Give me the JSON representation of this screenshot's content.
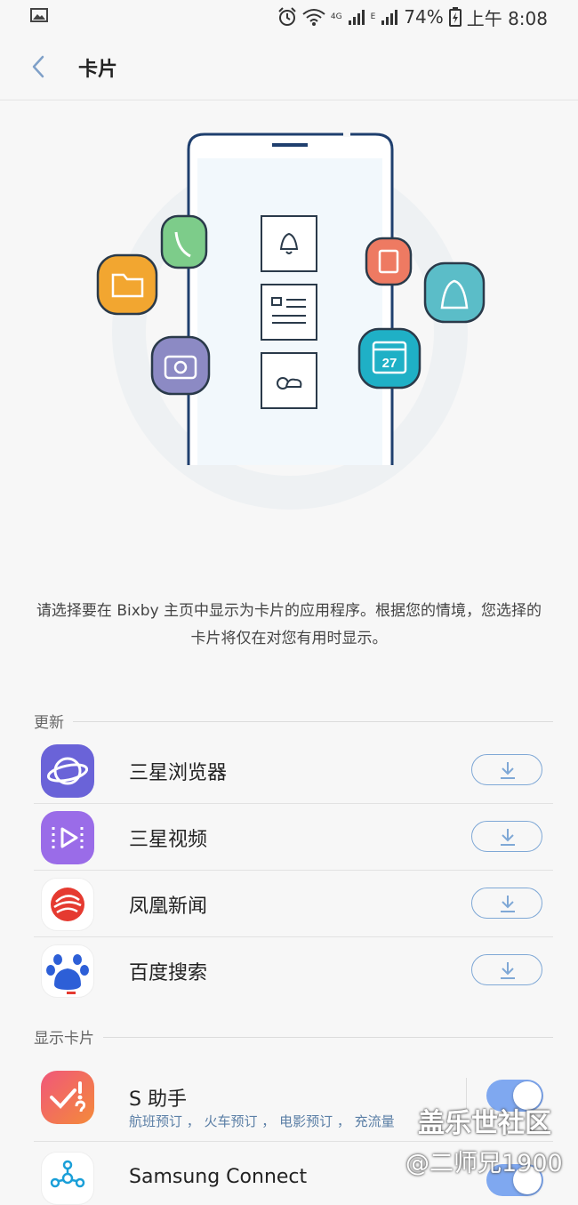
{
  "status_bar": {
    "network": "4G",
    "signal_label": "E",
    "battery": "74%",
    "time": "上午 8:08"
  },
  "header": {
    "title": "卡片"
  },
  "hero": {
    "calendar_day": "27"
  },
  "description": "请选择要在 Bixby 主页中显示为卡片的应用程序。根据您的情境，您选择的卡片将仅在对您有用时显示。",
  "sections": {
    "updates_label": "更新",
    "show_cards_label": "显示卡片"
  },
  "updates": [
    {
      "name": "三星浏览器",
      "icon": "samsung-internet-icon"
    },
    {
      "name": "三星视频",
      "icon": "samsung-video-icon"
    },
    {
      "name": "凤凰新闻",
      "icon": "ifeng-news-icon"
    },
    {
      "name": "百度搜索",
      "icon": "baidu-icon"
    }
  ],
  "cards": [
    {
      "name": "S 助手",
      "sub": "航班预订 ， 火车预订 ， 电影预订 ， 充流量",
      "icon": "s-assistant-icon",
      "enabled": true
    },
    {
      "name": "Samsung Connect",
      "icon": "samsung-connect-icon",
      "enabled": true
    }
  ],
  "watermark": {
    "line1": "盖乐世社区",
    "line2": "@二师兄1900"
  },
  "colors": {
    "accent": "#7fa8f0",
    "download_border": "#7fa8d6",
    "background": "#f7f7f7"
  }
}
